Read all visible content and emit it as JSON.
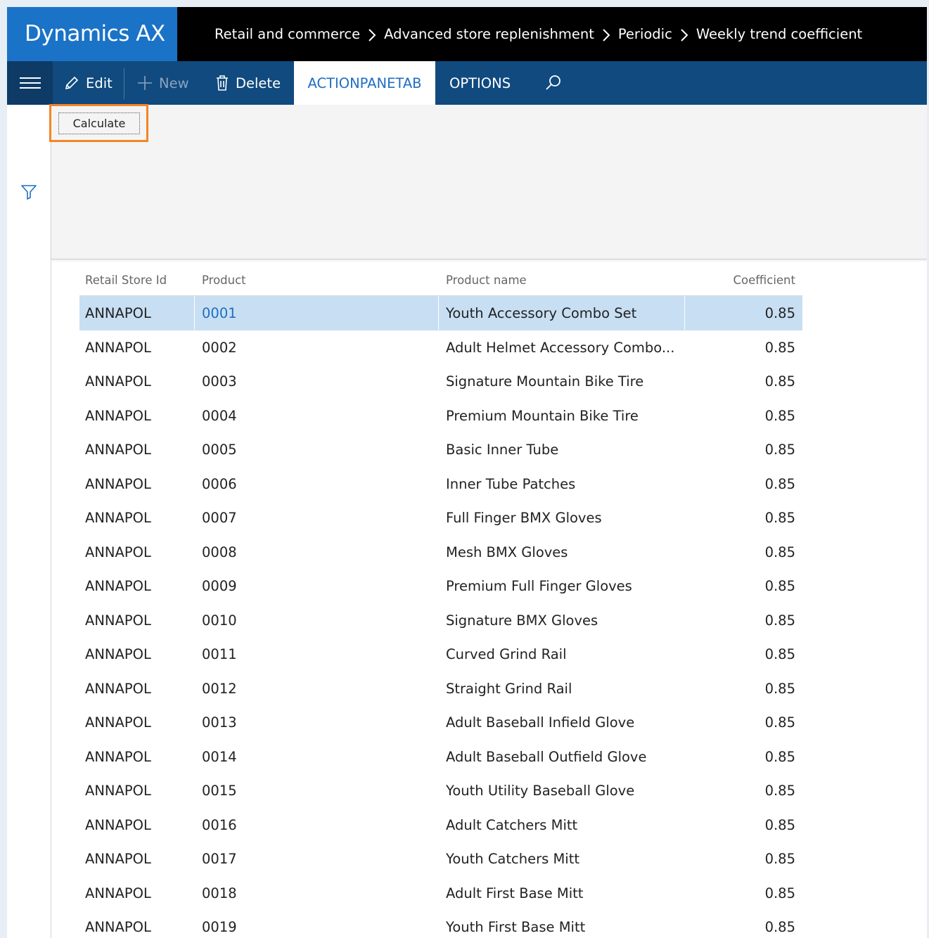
{
  "app": {
    "title": "Dynamics AX"
  },
  "breadcrumb": [
    "Retail and commerce",
    "Advanced store replenishment",
    "Periodic",
    "Weekly trend coefficient"
  ],
  "toolbar": {
    "edit_label": "Edit",
    "new_label": "New",
    "delete_label": "Delete",
    "active_tab": "ACTIONPANETAB",
    "options_tab": "OPTIONS"
  },
  "pane": {
    "calculate_label": "Calculate"
  },
  "colors": {
    "brand": "#1a73c7",
    "actionbar": "#104a7f",
    "selected_row": "#c8dff3",
    "highlight": "#f58426",
    "link": "#1f6fc2"
  },
  "grid": {
    "columns": [
      "Retail Store Id",
      "Product",
      "Product name",
      "Coefficient"
    ],
    "rows": [
      [
        "ANNAPOL",
        "0001",
        "Youth Accessory Combo Set",
        "0.85"
      ],
      [
        "ANNAPOL",
        "0002",
        "Adult Helmet Accessory Combo...",
        "0.85"
      ],
      [
        "ANNAPOL",
        "0003",
        "Signature Mountain Bike Tire",
        "0.85"
      ],
      [
        "ANNAPOL",
        "0004",
        "Premium Mountain Bike Tire",
        "0.85"
      ],
      [
        "ANNAPOL",
        "0005",
        "Basic Inner Tube",
        "0.85"
      ],
      [
        "ANNAPOL",
        "0006",
        "Inner Tube Patches",
        "0.85"
      ],
      [
        "ANNAPOL",
        "0007",
        "Full Finger BMX Gloves",
        "0.85"
      ],
      [
        "ANNAPOL",
        "0008",
        "Mesh BMX Gloves",
        "0.85"
      ],
      [
        "ANNAPOL",
        "0009",
        "Premium Full Finger Gloves",
        "0.85"
      ],
      [
        "ANNAPOL",
        "0010",
        "Signature BMX Gloves",
        "0.85"
      ],
      [
        "ANNAPOL",
        "0011",
        "Curved Grind Rail",
        "0.85"
      ],
      [
        "ANNAPOL",
        "0012",
        "Straight Grind Rail",
        "0.85"
      ],
      [
        "ANNAPOL",
        "0013",
        "Adult Baseball Infield Glove",
        "0.85"
      ],
      [
        "ANNAPOL",
        "0014",
        "Adult Baseball Outfield Glove",
        "0.85"
      ],
      [
        "ANNAPOL",
        "0015",
        "Youth Utility Baseball Glove",
        "0.85"
      ],
      [
        "ANNAPOL",
        "0016",
        "Adult Catchers Mitt",
        "0.85"
      ],
      [
        "ANNAPOL",
        "0017",
        "Youth Catchers Mitt",
        "0.85"
      ],
      [
        "ANNAPOL",
        "0018",
        "Adult First Base Mitt",
        "0.85"
      ],
      [
        "ANNAPOL",
        "0019",
        "Youth First Base Mitt",
        "0.85"
      ]
    ],
    "selected_index": 0
  }
}
